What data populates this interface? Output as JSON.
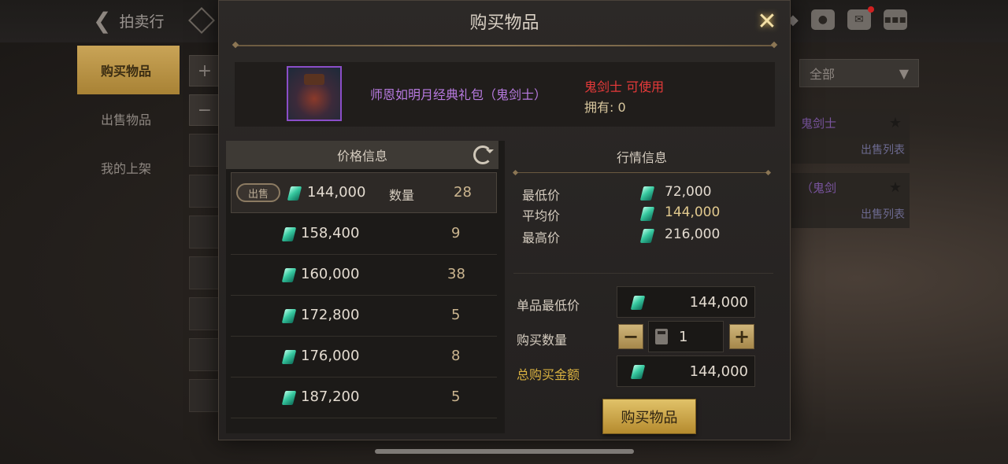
{
  "background": {
    "back_label": "拍卖行",
    "sidebar_tabs": [
      "购买物品",
      "出售物品",
      "我的上架"
    ],
    "filter_value": "全部",
    "cards": [
      {
        "name": "鬼剑士",
        "list_label": "出售列表"
      },
      {
        "name": "（鬼剑",
        "list_label": "出售列表"
      }
    ]
  },
  "dialog": {
    "title": "购买物品",
    "item": {
      "name": "师恩如明月经典礼包（鬼剑士）",
      "usable": "鬼剑士 可使用",
      "own_label": "拥有:",
      "own_value": "0"
    },
    "price_info": {
      "header": "价格信息",
      "sell_tag": "出售",
      "qty_label": "数量",
      "rows": [
        {
          "price": "144,000",
          "qty": "28"
        },
        {
          "price": "158,400",
          "qty": "9"
        },
        {
          "price": "160,000",
          "qty": "38"
        },
        {
          "price": "172,800",
          "qty": "5"
        },
        {
          "price": "176,000",
          "qty": "8"
        },
        {
          "price": "187,200",
          "qty": "5"
        }
      ]
    },
    "market": {
      "title": "行情信息",
      "min_label": "最低价",
      "min_value": "72,000",
      "avg_label": "平均价",
      "avg_value": "144,000",
      "max_label": "最高价",
      "max_value": "216,000"
    },
    "purchase": {
      "unit_label": "单品最低价",
      "unit_value": "144,000",
      "qty_label": "购买数量",
      "qty_value": "1",
      "total_label": "总购买金额",
      "total_value": "144,000",
      "buy_button": "购买物品"
    }
  },
  "colors": {
    "item_name": "#b77ae0",
    "usable": "#e83a3a",
    "gold": "#d8b040",
    "button": "#e1c269"
  }
}
